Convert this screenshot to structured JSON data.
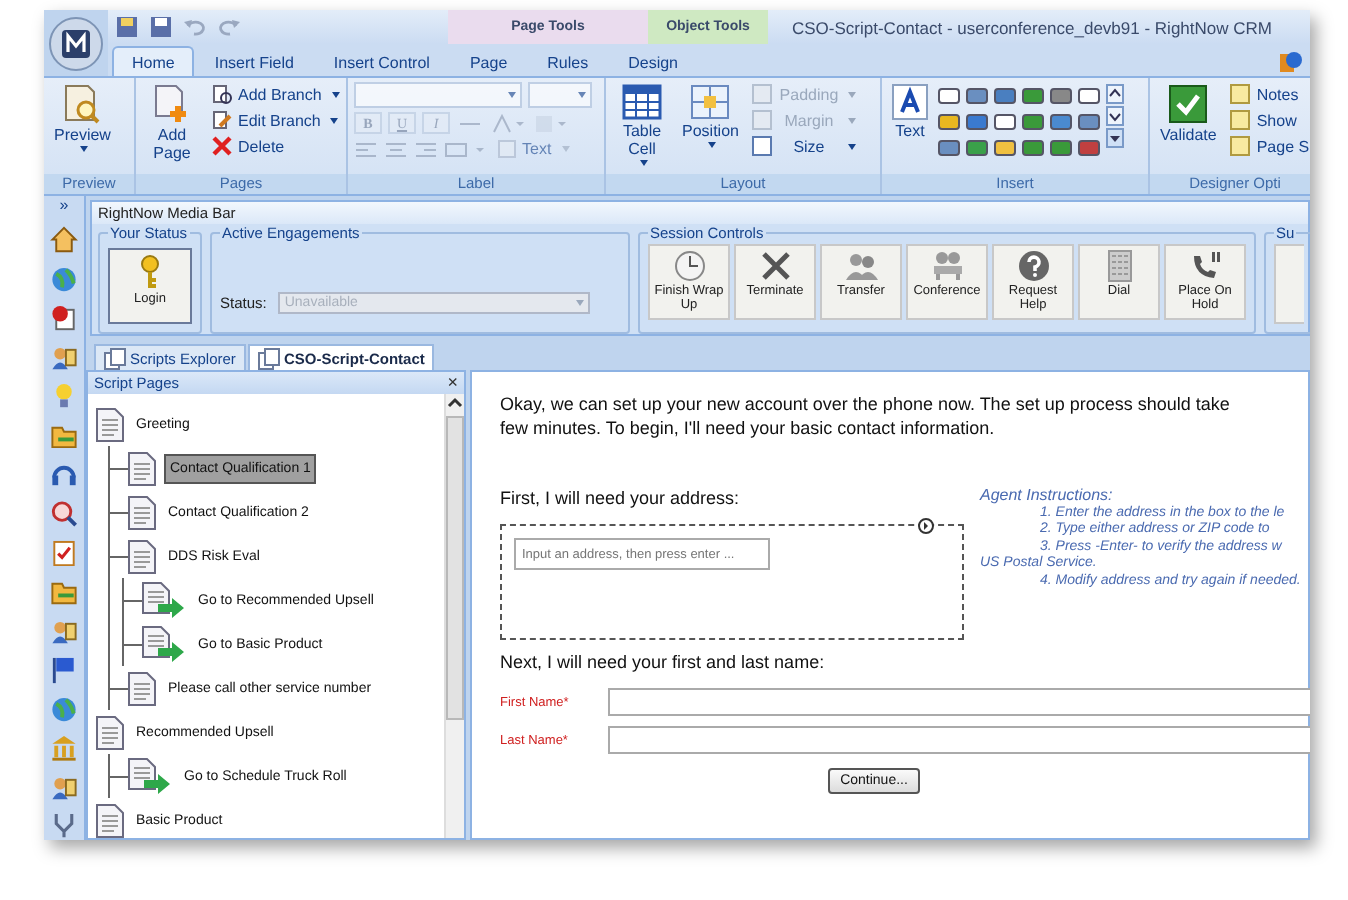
{
  "window": {
    "title": "CSO-Script-Contact  -  userconference_devb91  -  RightNow CRM"
  },
  "contextual_tabs": [
    {
      "label": "Page Tools",
      "color": "#eadcee"
    },
    {
      "label": "Object Tools",
      "color": "#cfe9c2"
    }
  ],
  "tabs": [
    {
      "label": "Home",
      "selected": true
    },
    {
      "label": "Insert Field",
      "selected": false
    },
    {
      "label": "Insert Control",
      "selected": false
    },
    {
      "label": "Page",
      "selected": false
    },
    {
      "label": "Rules",
      "selected": false
    },
    {
      "label": "Design",
      "selected": false
    }
  ],
  "ribbon": {
    "preview": {
      "group_label": "Preview",
      "button": "Preview"
    },
    "pages": {
      "group_label": "Pages",
      "add_page": "Add Page",
      "add_branch": "Add Branch",
      "edit_branch": "Edit Branch",
      "delete": "Delete"
    },
    "label": {
      "group_label": "Label",
      "format_buttons": [
        "B",
        "U",
        "I"
      ],
      "text_button": "Text",
      "disabled": true
    },
    "layout": {
      "group_label": "Layout",
      "table_cell": "Table Cell",
      "position": "Position",
      "options": [
        {
          "label": "Padding",
          "disabled": true
        },
        {
          "label": "Margin",
          "disabled": true
        },
        {
          "label": "Size",
          "disabled": false
        }
      ]
    },
    "insert": {
      "group_label": "Insert",
      "text_button": "Text"
    },
    "designer_options": {
      "group_label": "Designer Opti",
      "validate": "Validate",
      "items": [
        "Notes",
        "Show",
        "Page S"
      ]
    }
  },
  "sidebar": {
    "expand": "»"
  },
  "media_bar": {
    "title": "RightNow Media Bar",
    "your_status": {
      "label": "Your Status",
      "login": "Login"
    },
    "active_engagements": {
      "label": "Active Engagements",
      "status_label": "Status:",
      "status_value": "Unavailable",
      "disabled": true
    },
    "session_controls": {
      "label": "Session Controls",
      "buttons": [
        "Finish Wrap Up",
        "Terminate",
        "Transfer",
        "Conference",
        "Request Help",
        "Dial",
        "Place On Hold"
      ]
    },
    "cut_group_label": "Su"
  },
  "doc_tabs": [
    {
      "label": "Scripts Explorer",
      "selected": false
    },
    {
      "label": "CSO-Script-Contact",
      "selected": true
    }
  ],
  "script_pages": {
    "title": "Script Pages",
    "close": "×",
    "tree": [
      {
        "label": "Greeting",
        "kind": "page",
        "selected": false,
        "children": [
          {
            "label": "Contact Qualification 1",
            "kind": "page",
            "selected": true
          },
          {
            "label": "Contact Qualification 2",
            "kind": "page",
            "selected": false
          },
          {
            "label": "DDS Risk Eval",
            "kind": "page",
            "selected": false,
            "children": [
              {
                "label": "Go to Recommended Upsell",
                "kind": "branch",
                "selected": false
              },
              {
                "label": "Go to Basic Product",
                "kind": "branch",
                "selected": false
              }
            ]
          },
          {
            "label": "Please call other service number",
            "kind": "page",
            "selected": false
          }
        ]
      },
      {
        "label": "Recommended Upsell",
        "kind": "page",
        "selected": false,
        "children": [
          {
            "label": "Go to Schedule Truck Roll",
            "kind": "branch",
            "selected": false
          }
        ]
      },
      {
        "label": "Basic Product",
        "kind": "page",
        "selected": false
      }
    ]
  },
  "form": {
    "intro_lines": [
      "Okay, we can set up your new account over the phone now. The set up process should take",
      "few minutes. To begin, I'll need your basic contact information."
    ],
    "address_prompt": "First, I will need your address:",
    "address_placeholder": "Input an address, then press enter ...",
    "agent_instructions": {
      "title": "Agent Instructions:",
      "lines": [
        {
          "text": "1. Enter the address in the box to the le",
          "indent": true
        },
        {
          "text": "2. Type either address or ZIP code to",
          "indent": true
        },
        {
          "text": "3. Press -Enter- to verify the address w",
          "indent": true
        },
        {
          "text": "US Postal Service.",
          "indent": false
        },
        {
          "text": "4. Modify address and try again if needed.",
          "indent": true
        }
      ]
    },
    "name_prompt": "Next, I will need your first and last name:",
    "fields": [
      {
        "label": "First Name*",
        "required": true
      },
      {
        "label": "Last Name*",
        "required": true
      }
    ],
    "continue_button": "Continue..."
  }
}
